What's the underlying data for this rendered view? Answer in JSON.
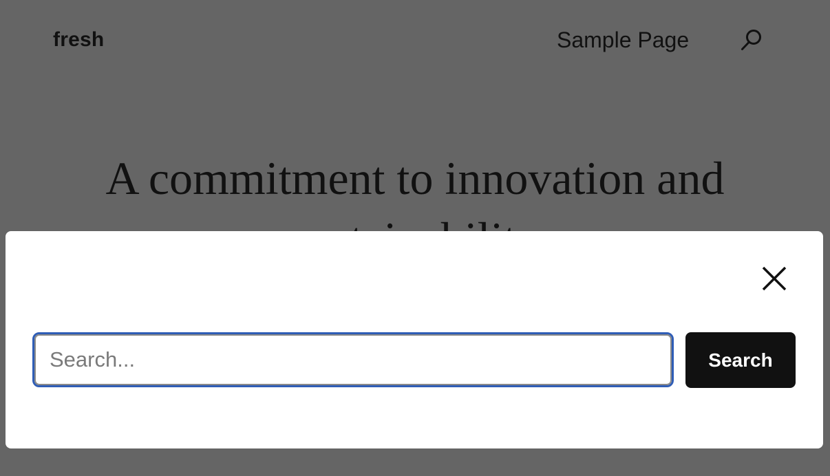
{
  "header": {
    "site_title": "fresh",
    "nav_items": [
      {
        "label": "Sample Page"
      }
    ],
    "search_icon": "search-icon"
  },
  "hero": {
    "title": "A commitment to innovation and sustainability"
  },
  "search_modal": {
    "close_icon": "close-icon",
    "input": {
      "value": "",
      "placeholder": "Search..."
    },
    "submit_label": "Search"
  },
  "colors": {
    "overlay_background": "#656565",
    "modal_background": "#ffffff",
    "focus_ring": "#2f5db6",
    "button_background": "#111111",
    "button_text": "#ffffff",
    "text": "#111111"
  }
}
